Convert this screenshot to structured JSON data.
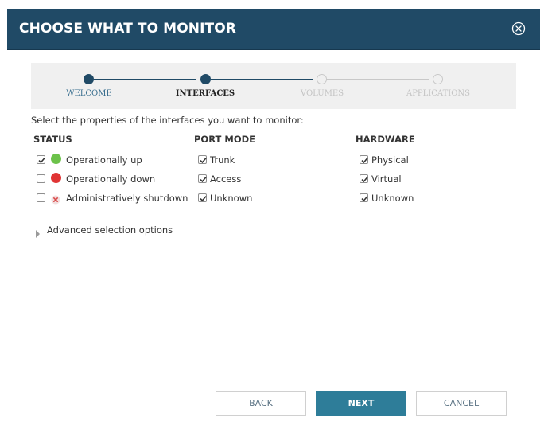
{
  "dialog": {
    "title": "CHOOSE WHAT TO MONITOR",
    "close_icon": "close-circle-icon"
  },
  "stepper": {
    "steps": [
      {
        "label": "WELCOME",
        "state": "completed"
      },
      {
        "label": "INTERFACES",
        "state": "current"
      },
      {
        "label": "VOLUMES",
        "state": "upcoming"
      },
      {
        "label": "APPLICATIONS",
        "state": "upcoming"
      }
    ]
  },
  "intro_text": "Select the properties of the interfaces you want to monitor:",
  "status": {
    "heading": "STATUS",
    "options": [
      {
        "label": "Operationally up",
        "checked": true,
        "icon": "green-dot-icon",
        "color": "#6cc24a"
      },
      {
        "label": "Operationally down",
        "checked": false,
        "icon": "red-dot-icon",
        "color": "#e03434"
      },
      {
        "label": "Administratively shutdown",
        "checked": false,
        "icon": "red-x-icon",
        "color": "#d94848"
      }
    ]
  },
  "port_mode": {
    "heading": "PORT MODE",
    "options": [
      {
        "label": "Trunk",
        "checked": true
      },
      {
        "label": "Access",
        "checked": true
      },
      {
        "label": "Unknown",
        "checked": true
      }
    ]
  },
  "hardware": {
    "heading": "HARDWARE",
    "options": [
      {
        "label": "Physical",
        "checked": true
      },
      {
        "label": "Virtual",
        "checked": true
      },
      {
        "label": "Unknown",
        "checked": true
      }
    ]
  },
  "advanced": {
    "label": "Advanced selection options",
    "icon": "caret-right-icon"
  },
  "buttons": {
    "back": "BACK",
    "next": "NEXT",
    "cancel": "CANCEL"
  },
  "colors": {
    "header_bg": "#204a66",
    "primary_button": "#2e7d99",
    "step_done": "#204a66",
    "step_upcoming": "#c8c8c8"
  }
}
